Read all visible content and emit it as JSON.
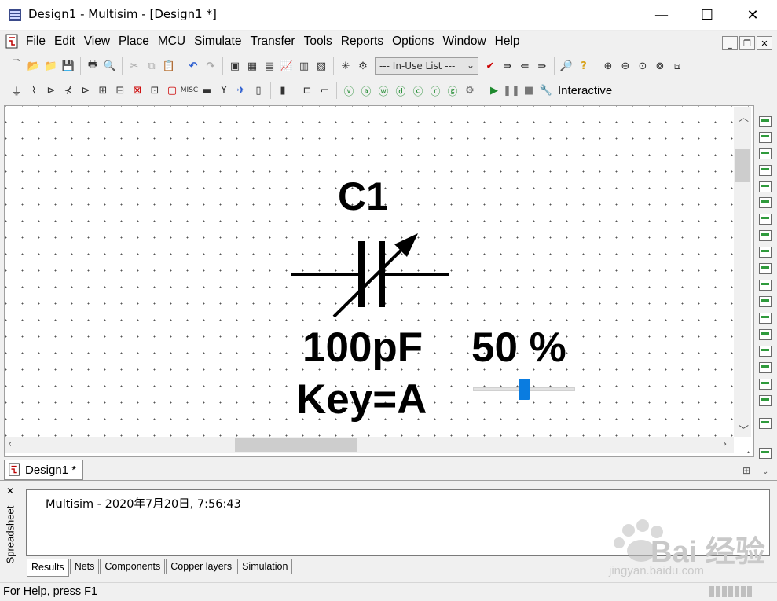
{
  "window": {
    "title": "Design1 - Multisim - [Design1 *]",
    "minimize_label": "—",
    "maximize_label": "☐",
    "close_label": "✕"
  },
  "menu": {
    "items": [
      {
        "ul": "F",
        "rest": "ile"
      },
      {
        "ul": "E",
        "rest": "dit"
      },
      {
        "ul": "V",
        "rest": "iew"
      },
      {
        "ul": "P",
        "rest": "lace"
      },
      {
        "ul": "M",
        "rest": "CU"
      },
      {
        "ul": "S",
        "rest": "imulate"
      },
      {
        "ul": "",
        "pre": "Tra",
        "mid": "n",
        "rest": "sfer"
      },
      {
        "ul": "T",
        "rest": "ools"
      },
      {
        "ul": "R",
        "rest": "eports"
      },
      {
        "ul": "O",
        "rest": "ptions"
      },
      {
        "ul": "W",
        "rest": "indow"
      },
      {
        "ul": "H",
        "rest": "elp"
      }
    ],
    "mdi_minimize": "_",
    "mdi_restore": "❐",
    "mdi_close": "✕"
  },
  "toolbar": {
    "inuse_list": "--- In-Use List ---",
    "interactive_label": "Interactive"
  },
  "schematic": {
    "ref": "C1",
    "value": "100pF",
    "key": "Key=A",
    "percent_label": "50 %",
    "percent": 50
  },
  "tabs": {
    "design_tab": "Design1 *"
  },
  "spreadsheet": {
    "side_label": "Spreadsheet",
    "log_line": "Multisim  -  2020年7月20日, 7:56:43",
    "tabs": [
      "Results",
      "Nets",
      "Components",
      "Copper layers",
      "Simulation"
    ]
  },
  "status": {
    "help_text": "For Help, press F1"
  },
  "watermark": {
    "brand": "Bai 经验",
    "url": "jingyan.baidu.com"
  }
}
